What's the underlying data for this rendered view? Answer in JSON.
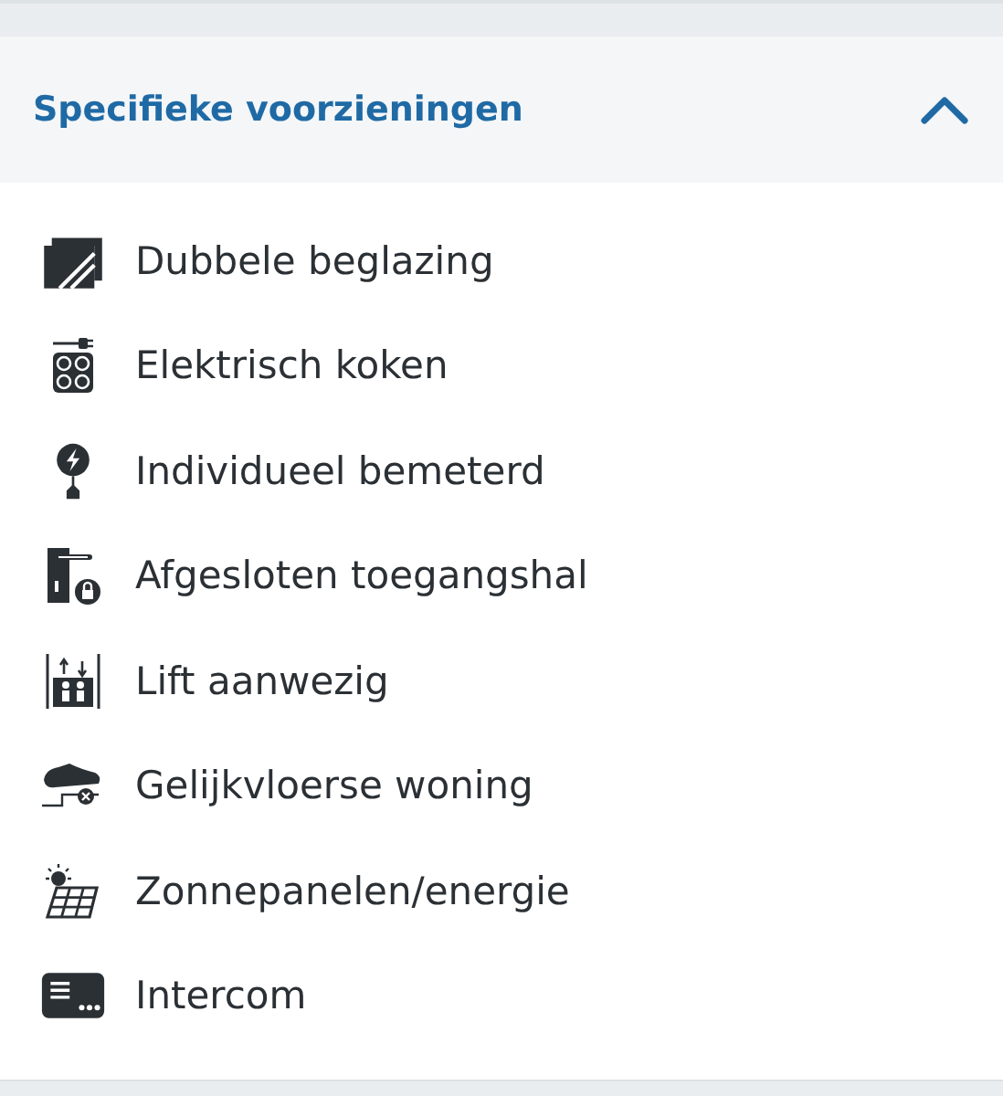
{
  "section": {
    "title": "Specifieke voorzieningen",
    "expanded": true
  },
  "items": [
    {
      "kind": "glazing",
      "label": "Dubbele beglazing"
    },
    {
      "kind": "cooking",
      "label": "Elektrisch koken"
    },
    {
      "kind": "meter",
      "label": "Individueel bemeterd"
    },
    {
      "kind": "door",
      "label": "Afgesloten toegangshal"
    },
    {
      "kind": "lift",
      "label": "Lift aanwezig"
    },
    {
      "kind": "floor",
      "label": "Gelijkvloerse woning"
    },
    {
      "kind": "solar",
      "label": "Zonnepanelen/energie"
    },
    {
      "kind": "intercom",
      "label": "Intercom"
    }
  ]
}
